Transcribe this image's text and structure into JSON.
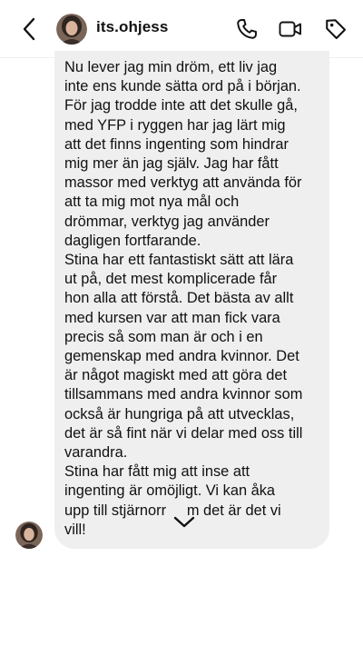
{
  "header": {
    "username": "its.ohjess",
    "back_icon": "chevron-left-icon",
    "call_icon": "phone-icon",
    "video_icon": "video-camera-icon",
    "tag_icon": "tag-icon"
  },
  "message": {
    "text": "Nu lever jag min dröm, ett liv jag\ninte ens kunde sätta ord på i början.\nFör jag trodde inte att det skulle gå,\nmed YFP i ryggen har jag lärt mig\natt det finns ingenting som hindrar\nmig mer än jag själv. Jag har fått\nmassor med verktyg att använda för\natt ta mig mot nya mål och\ndrömmar, verktyg jag använder\ndagligen fortfarande.\nStina har ett fantastiskt sätt att lära\nut på, det mest komplicerade får\nhon alla att förstå. Det bästa av allt\nmed kursen var att man fick vara\nprecis så som man är och i en\ngemenskap med andra kvinnor. Det\när något magiskt med att göra det\ntillsammans med andra kvinnor som\nockså är hungriga på att utvecklas,\ndet är så fint när vi delar med oss till\nvarandra.\nStina har fått mig att inse att\ningenting är omöjligt. Vi kan åka\nupp till stjärnorr     m det är det vi\nvill!",
    "expand_icon": "chevron-down-icon"
  },
  "colors": {
    "bubble": "#efefef",
    "text": "#111111",
    "background": "#ffffff"
  }
}
